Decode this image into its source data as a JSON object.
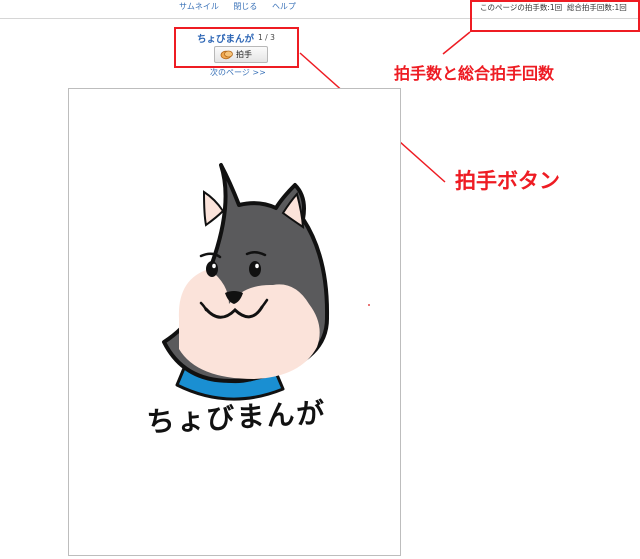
{
  "nav": {
    "thumbnail": "サムネイル",
    "close": "閉じる",
    "help": "ヘルプ"
  },
  "counts": {
    "page_claps": "このページの拍手数:1回",
    "total_claps": "総合拍手回数:1回"
  },
  "manga": {
    "title": "ちょびまんが",
    "page_indicator": "1 / 3",
    "clap_button_label": "拍手",
    "next_page": "次のページ >>",
    "cover_text": "ちょびまんが"
  },
  "annotations": {
    "counts_note": "拍手数と総合拍手回数",
    "button_note": "拍手ボタン"
  },
  "colors": {
    "link": "#3a72b8",
    "title": "#2d66b5",
    "annotation_red": "#ee1c23",
    "dog_fur": "#5a5a5c",
    "dog_face": "#fbe3da",
    "collar": "#1a8fd2"
  },
  "icons": {
    "clap": "clap-hands-icon"
  }
}
